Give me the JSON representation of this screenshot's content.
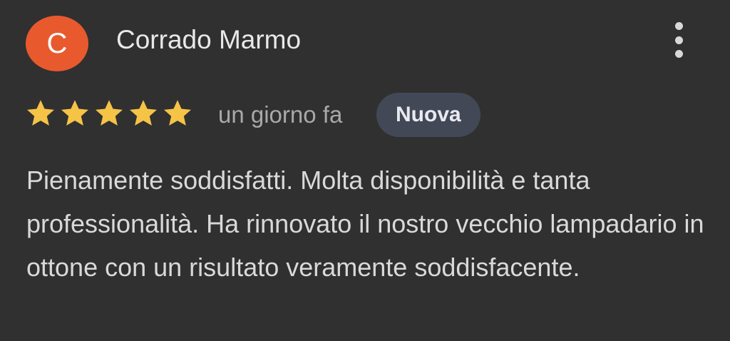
{
  "review": {
    "avatar_letter": "C",
    "author": "Corrado Marmo",
    "rating": 5,
    "rating_max": 5,
    "time": "un giorno fa",
    "badge": "Nuova",
    "text": "Pienamente soddisfatti. Molta disponibilità e tanta professionalità. Ha rinnovato il nostro vecchio lampadario in ottone con un risultato veramente soddisfacente."
  },
  "colors": {
    "background": "#303030",
    "avatar": "#e9592e",
    "star": "#f5c346",
    "badge_bg": "#434857"
  },
  "icons": {
    "menu": "more-vert-icon",
    "star": "star-icon"
  }
}
